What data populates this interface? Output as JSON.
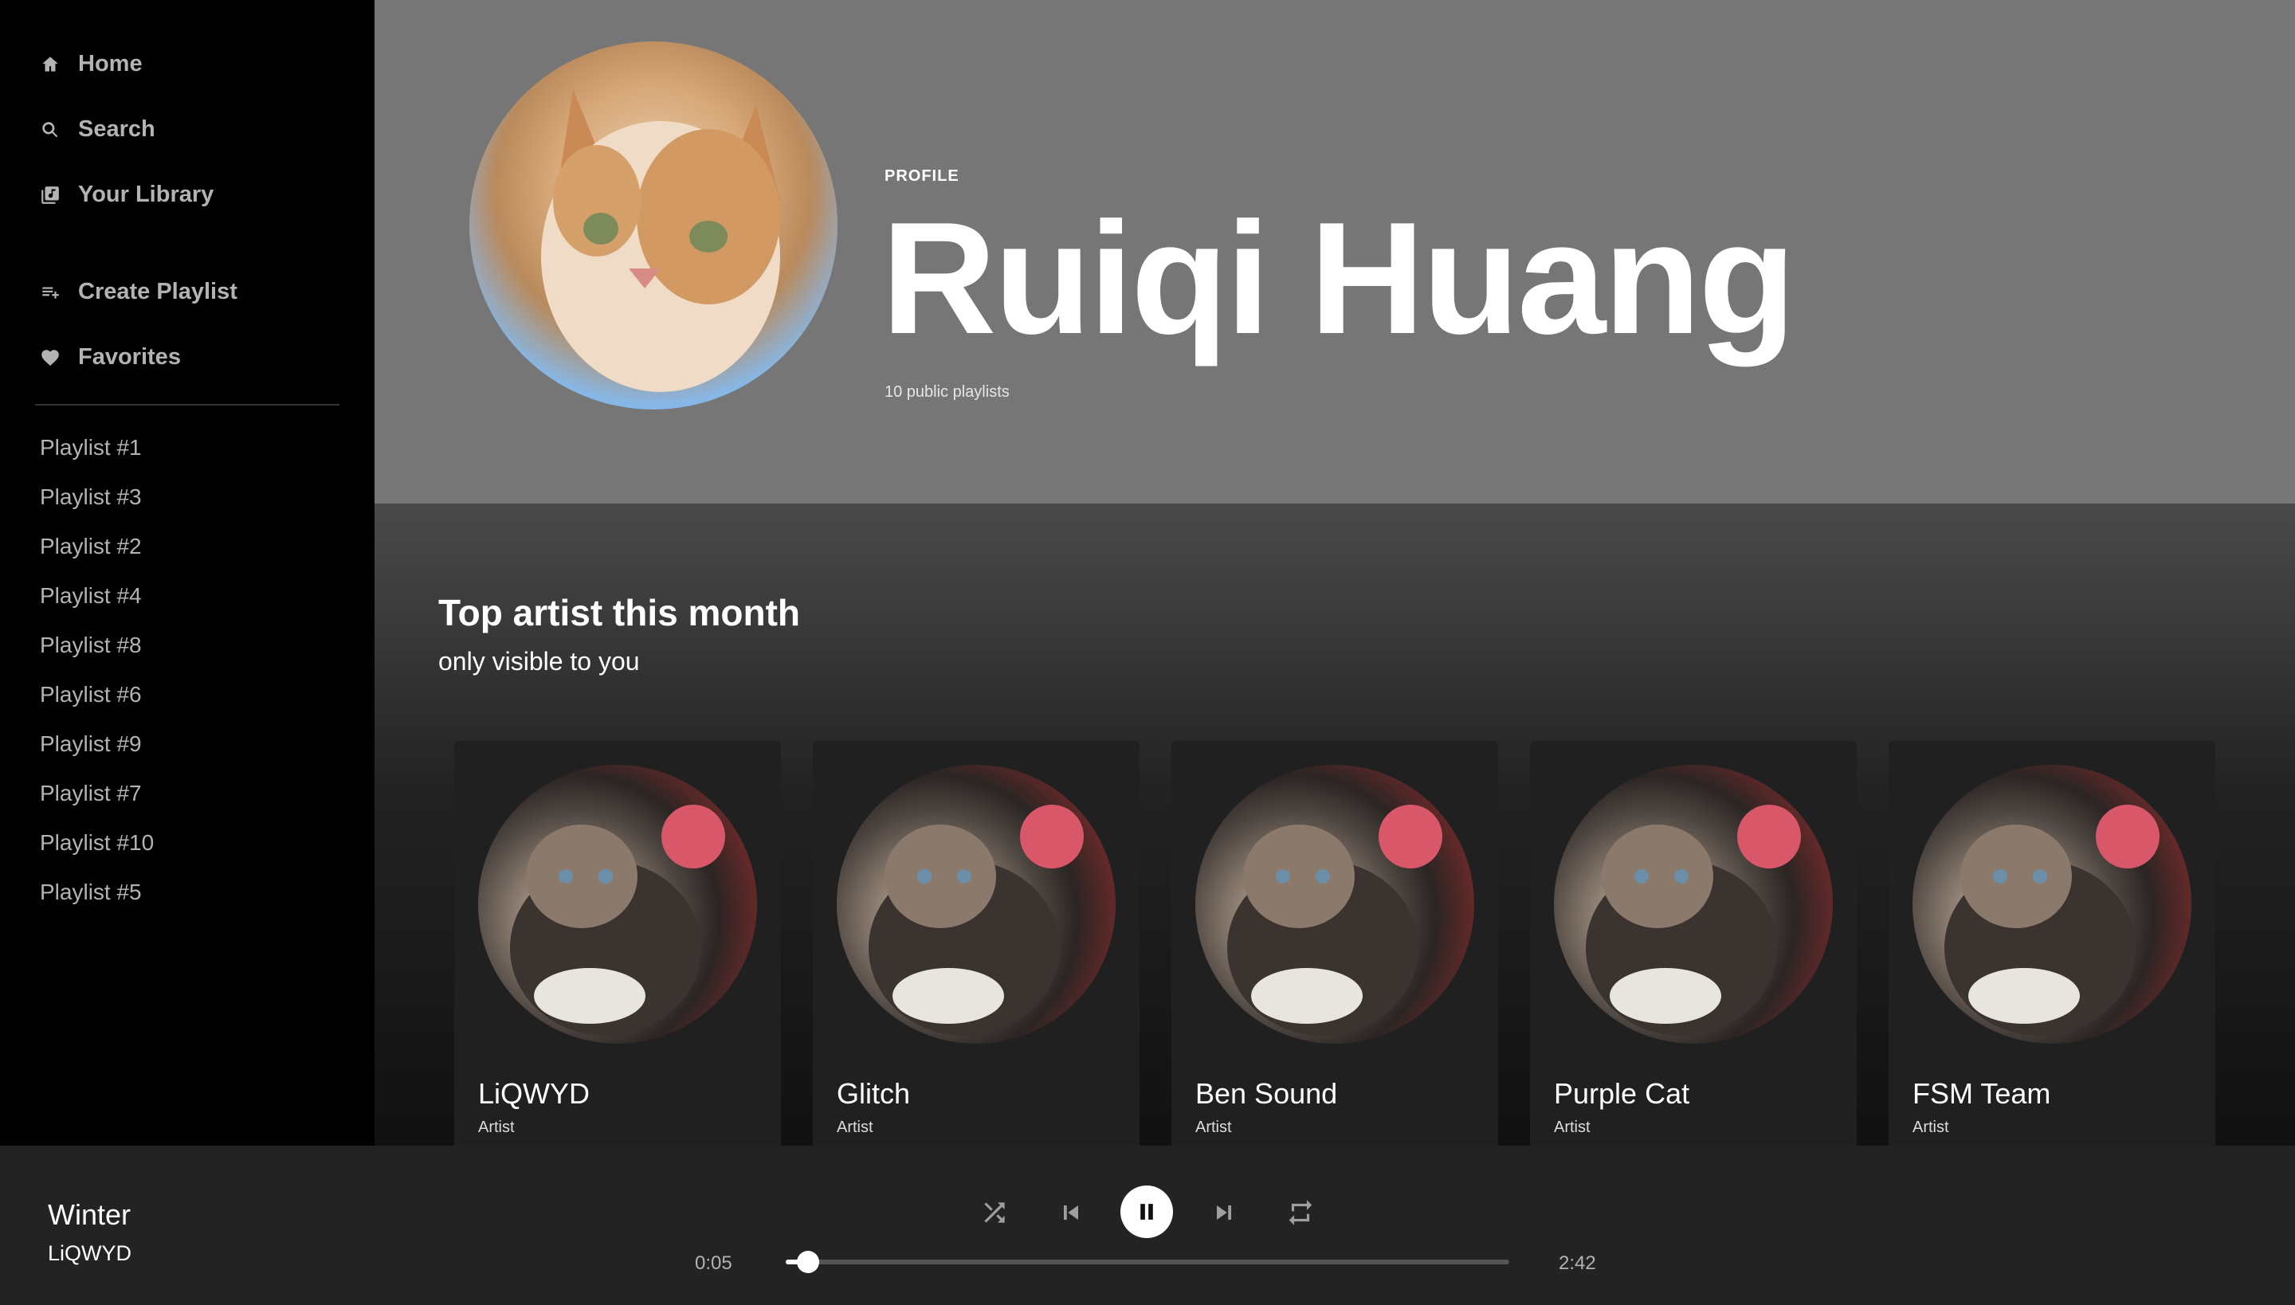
{
  "sidebar": {
    "nav": [
      {
        "label": "Home",
        "icon": "home-icon"
      },
      {
        "label": "Search",
        "icon": "search-icon"
      },
      {
        "label": "Your Library",
        "icon": "library-icon"
      },
      {
        "label": "Create Playlist",
        "icon": "playlist-add-icon"
      },
      {
        "label": "Favorites",
        "icon": "heart-icon"
      }
    ],
    "playlists": [
      "Playlist #1",
      "Playlist #3",
      "Playlist #2",
      "Playlist #4",
      "Playlist #8",
      "Playlist #6",
      "Playlist #9",
      "Playlist #7",
      "Playlist #10",
      "Playlist #5"
    ]
  },
  "header": {
    "label": "PROFILE",
    "name": "Ruiqi Huang",
    "public_playlists": "10 public playlists",
    "background_color": "#767676"
  },
  "main": {
    "section_title": "Top artist this month",
    "section_subtitle": "only visible to you",
    "artists": [
      {
        "name": "LiQWYD",
        "type": "Artist"
      },
      {
        "name": "Glitch",
        "type": "Artist"
      },
      {
        "name": "Ben Sound",
        "type": "Artist"
      },
      {
        "name": "Purple Cat",
        "type": "Artist"
      },
      {
        "name": "FSM Team",
        "type": "Artist"
      }
    ]
  },
  "player": {
    "title": "Winter",
    "artist": "LiQWYD",
    "elapsed": "0:05",
    "duration": "2:42",
    "progress_fraction": 0.031,
    "controls": [
      "shuffle-icon",
      "previous-icon",
      "pause-icon",
      "next-icon",
      "repeat-icon"
    ]
  }
}
